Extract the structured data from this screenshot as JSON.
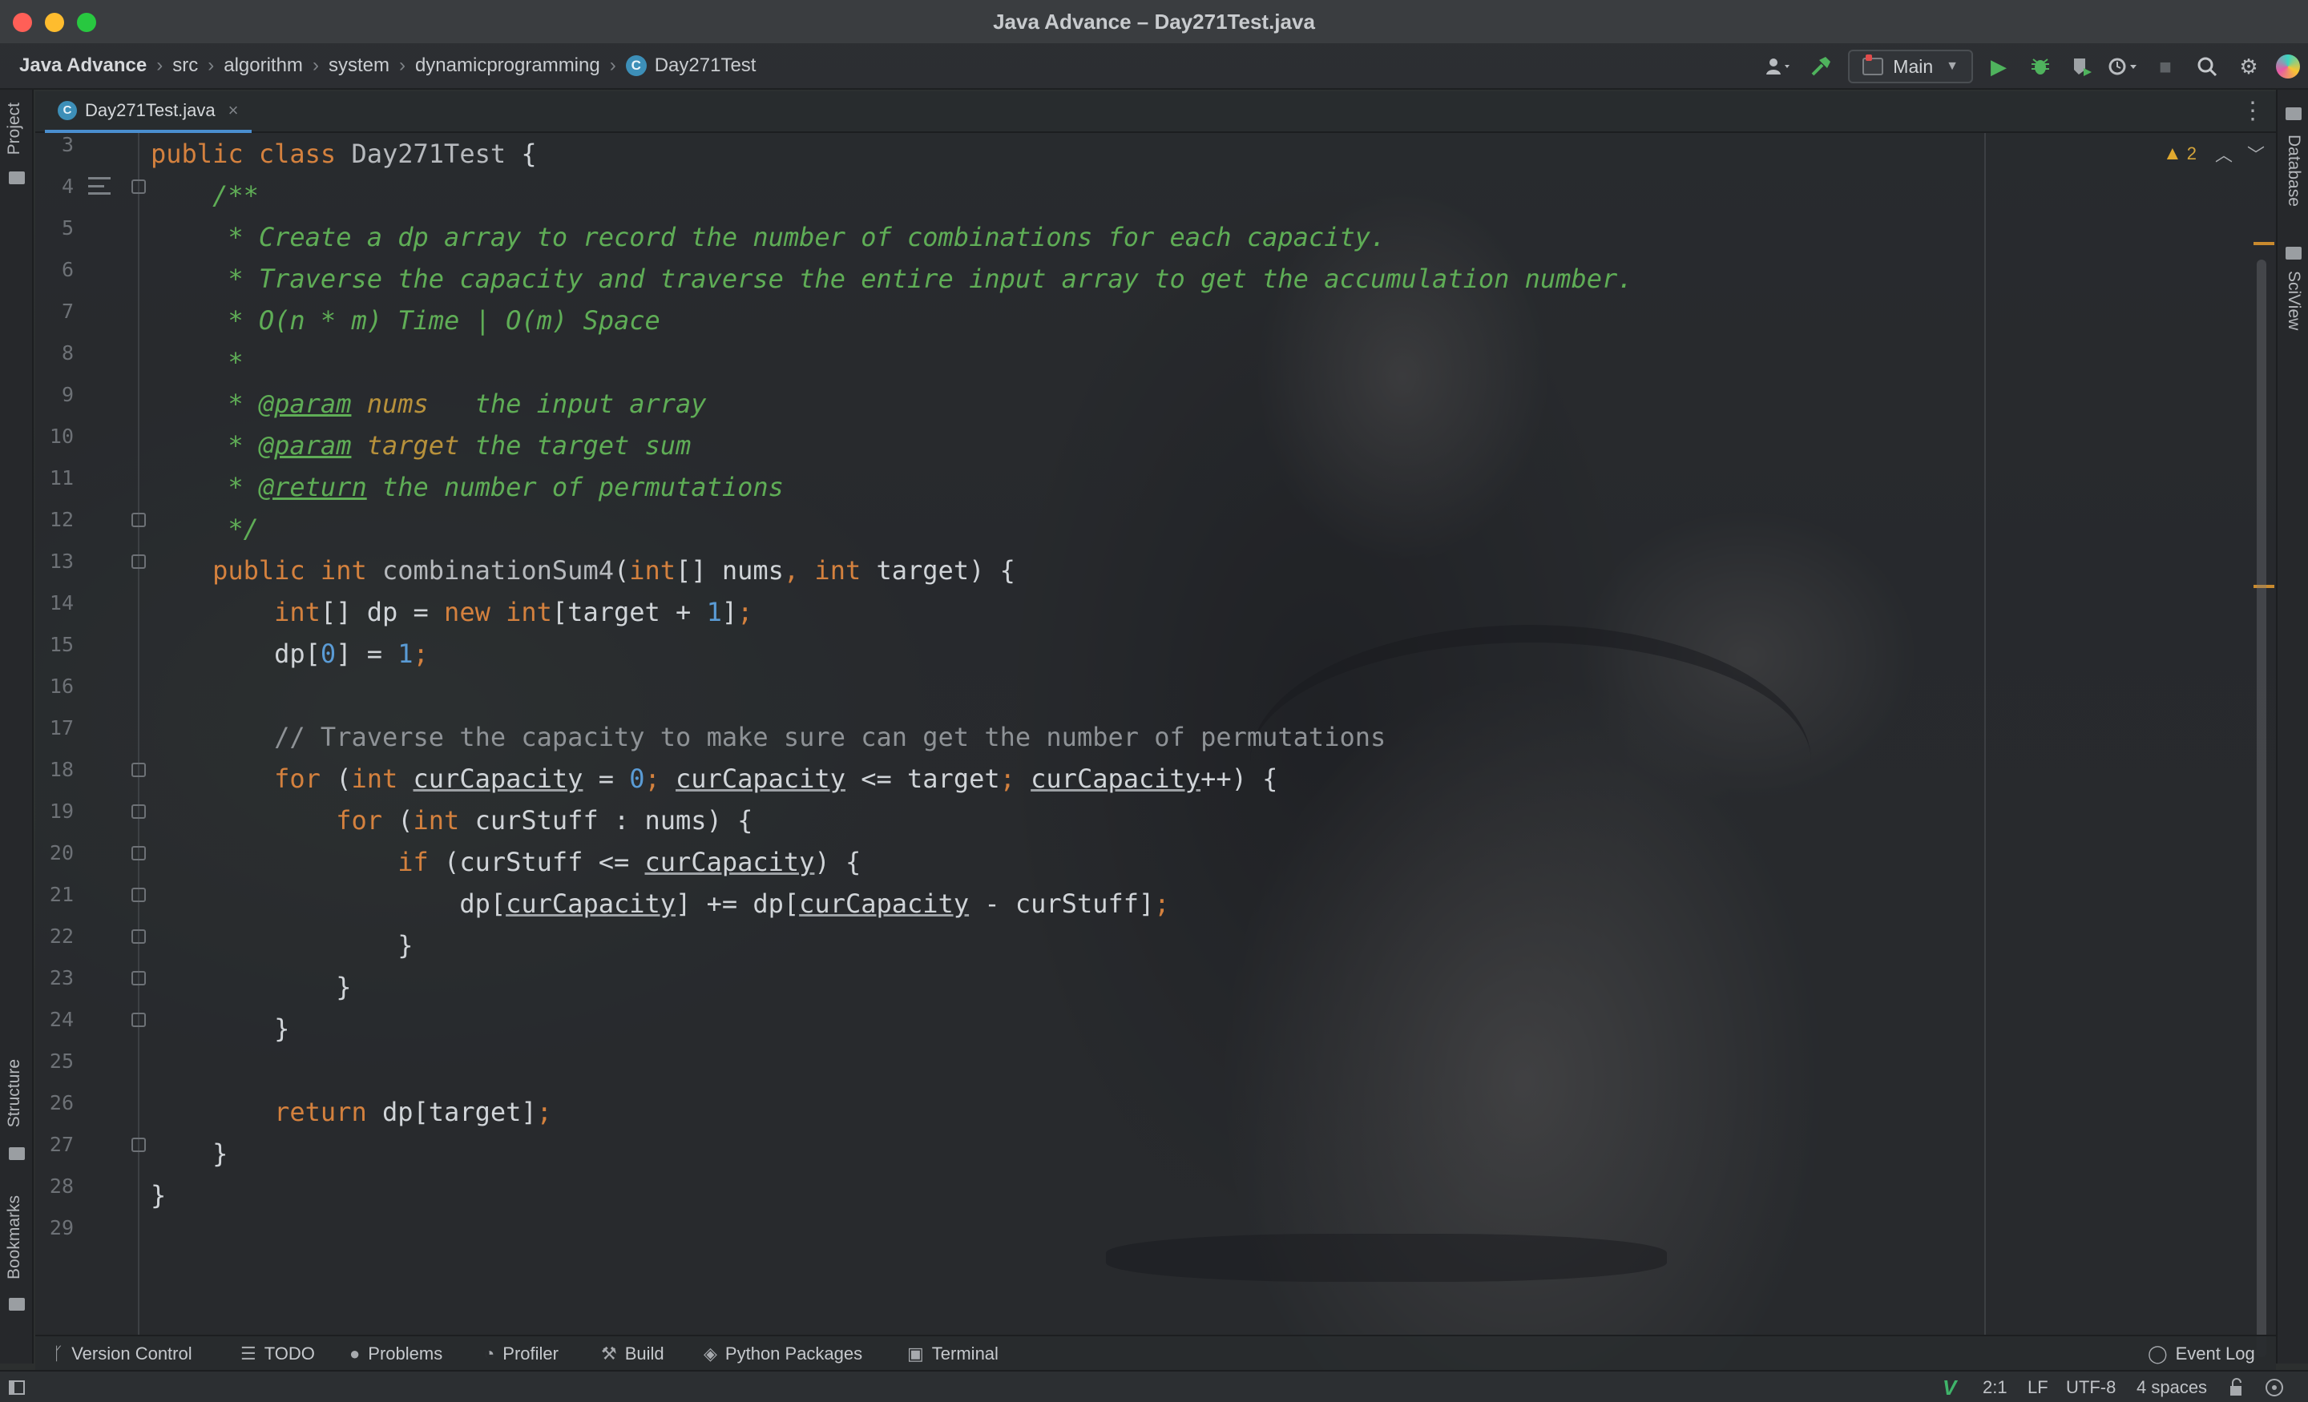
{
  "window": {
    "title": "Java Advance – Day271Test.java"
  },
  "breadcrumb": [
    "Java Advance",
    "src",
    "algorithm",
    "system",
    "dynamicprogramming",
    "Day271Test"
  ],
  "toolbar": {
    "run_config": "Main",
    "icons": [
      "user-icon",
      "build-hammer-icon",
      "run-icon",
      "debug-icon",
      "coverage-icon",
      "profile-icon",
      "stop-icon",
      "search-icon",
      "settings-icon",
      "ai-assistant-icon"
    ]
  },
  "left_tools": {
    "project": "Project",
    "structure": "Structure",
    "bookmarks": "Bookmarks"
  },
  "right_tools": {
    "database": "Database",
    "sciview": "SciView"
  },
  "tab": {
    "label": "Day271Test.java",
    "badge": "C"
  },
  "inspections": {
    "warnings": "2"
  },
  "code": {
    "lines": [
      {
        "n": "3"
      },
      {
        "n": "4"
      },
      {
        "n": "5"
      },
      {
        "n": "6"
      },
      {
        "n": "7"
      },
      {
        "n": "8"
      },
      {
        "n": "9"
      },
      {
        "n": "10"
      },
      {
        "n": "11"
      },
      {
        "n": "12"
      },
      {
        "n": "13"
      },
      {
        "n": "14"
      },
      {
        "n": "15"
      },
      {
        "n": "16"
      },
      {
        "n": "17"
      },
      {
        "n": "18"
      },
      {
        "n": "19"
      },
      {
        "n": "20"
      },
      {
        "n": "21"
      },
      {
        "n": "22"
      },
      {
        "n": "23"
      },
      {
        "n": "24"
      },
      {
        "n": "25"
      },
      {
        "n": "26"
      },
      {
        "n": "27"
      },
      {
        "n": "28"
      },
      {
        "n": "29"
      }
    ],
    "t": {
      "public": "public",
      "class": "class",
      "classname": "Day271Test",
      "brace_open": "{",
      "brace_close": "}",
      "doc_open": "/**",
      "doc_l5": " * Create a dp array to record the number of combinations for each capacity.",
      "doc_l6": " * Traverse the capacity and traverse the entire input array to get the accumulation number.",
      "doc_l7": " * O(n * m) Time | O(m) Space",
      "doc_l8": " *",
      "doc_star": " * ",
      "doc_param": "@param",
      "doc_return": "@return",
      "p_nums": "nums",
      "p_nums_desc": "   the input array",
      "p_target": "target",
      "p_target_desc": " the target sum",
      "return_desc": " the number of permutations",
      "doc_close": " */",
      "int": "int",
      "method": "combinationSum4",
      "sig_rest_1": "(",
      "sig_rest_2": "[] nums",
      "comma": ",",
      "sig_rest_3": " target) {",
      "l14_a": "[] dp = ",
      "new": "new",
      "l14_b": "[target + ",
      "one": "1",
      "l14_c": "]",
      "semi": ";",
      "l15_a": "dp[",
      "zero": "0",
      "l15_b": "] = ",
      "l17": "// Traverse the capacity to make sure can get the number of permutations",
      "for": "for",
      "paren_open": " (",
      "curCapacity": "curCapacity",
      "l18_eq": " = ",
      "l18_le": " <= target",
      "l18_inc": "++) {",
      "l19_rest": " curStuff : nums) {",
      "if": "if",
      "l20_a": " (curStuff <= ",
      "l20_b": ") {",
      "l21_a": "dp[",
      "l21_b": "] += dp[",
      "l21_c": " - curStuff]",
      "return": "return",
      "l26_rest": " dp[target]"
    }
  },
  "bottom_tools": [
    "Version Control",
    "TODO",
    "Problems",
    "Profiler",
    "Build",
    "Python Packages",
    "Terminal",
    "Event Log"
  ],
  "status": {
    "position": "2:1",
    "line_ending": "LF",
    "encoding": "UTF-8",
    "indent": "4 spaces"
  }
}
